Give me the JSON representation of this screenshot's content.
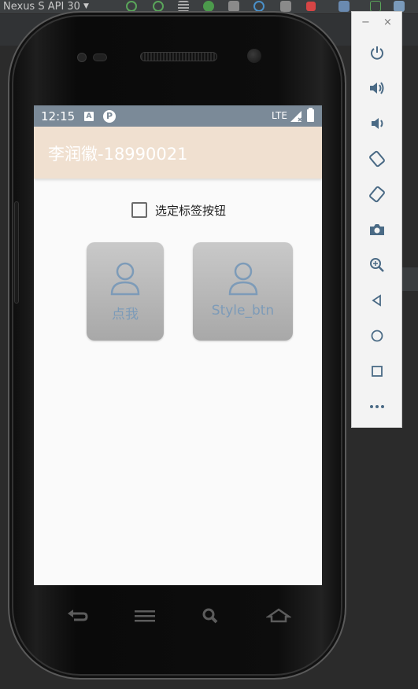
{
  "ide": {
    "device_name": "Nexus S API 30"
  },
  "status_bar": {
    "time": "12:15",
    "notification_a": "A",
    "notification_p": "P",
    "network": "LTE"
  },
  "app_bar": {
    "title": "李润徽-18990021"
  },
  "checkbox": {
    "label": "选定标签按钮",
    "checked": false
  },
  "buttons": [
    {
      "label": "点我",
      "icon": "user-icon"
    },
    {
      "label": "Style_btn",
      "icon": "user-icon"
    }
  ],
  "emulator_panel": {
    "minimize": "−",
    "close": "×",
    "controls": [
      "power-icon",
      "volume-up-icon",
      "volume-down-icon",
      "rotate-left-icon",
      "rotate-right-icon",
      "camera-icon",
      "zoom-icon",
      "back-icon",
      "home-icon",
      "overview-icon",
      "more-icon"
    ]
  },
  "colors": {
    "status_bar": "#7b8a98",
    "app_bar": "#f0e0d0",
    "button_label": "#7d9bb8",
    "emulator_icon": "#4a6a85"
  }
}
